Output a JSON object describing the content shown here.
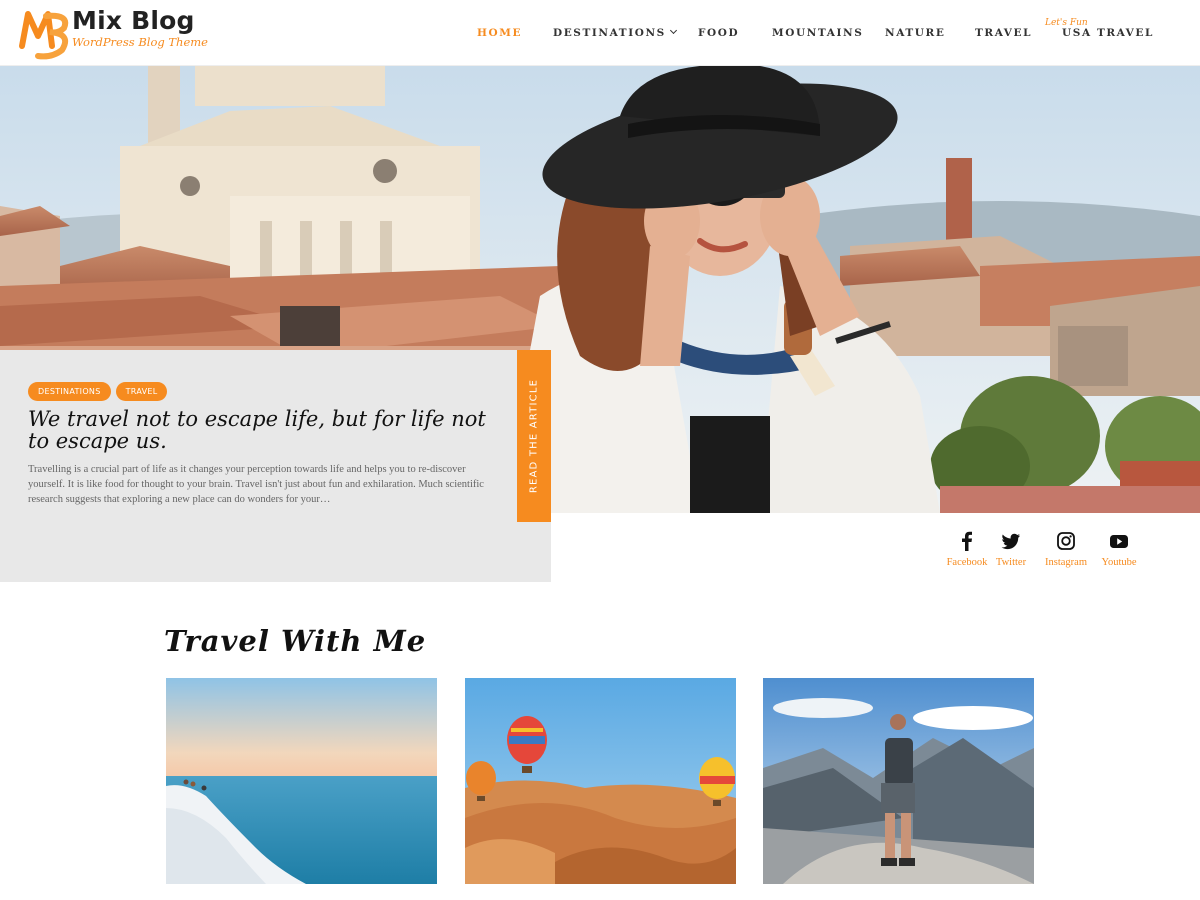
{
  "brand": {
    "title": "Mix Blog",
    "tagline": "WordPress Blog Theme",
    "logo_letters": "MB",
    "accent": "#f68b1f"
  },
  "nav": {
    "items": [
      {
        "label": "Home",
        "active": true
      },
      {
        "label": "Destinations",
        "has_dropdown": true
      },
      {
        "label": "Food"
      },
      {
        "label": "Mountains"
      },
      {
        "label": "Nature"
      },
      {
        "label": "Travel"
      },
      {
        "label": "USA Travel"
      }
    ],
    "sub_caption": "Let's Fun"
  },
  "hero": {
    "tags": [
      "DESTINATIONS",
      "TRAVEL"
    ],
    "title": "We travel not to escape life, but for life not to escape us.",
    "excerpt": "Travelling is a crucial part of life as it changes your perception towards life and helps you to re-discover yourself. It is like food for thought to your brain. Travel isn't just about fun and exhilaration. Much scientific research suggests that exploring a new place can do wonders for your…",
    "read_label": "READ THE ARTICLE"
  },
  "social": [
    {
      "label": "Facebook",
      "icon": "facebook-icon"
    },
    {
      "label": "Twitter",
      "icon": "twitter-icon"
    },
    {
      "label": "Instagram",
      "icon": "instagram-icon"
    },
    {
      "label": "Youtube",
      "icon": "youtube-icon"
    }
  ],
  "section": {
    "title": "Travel With Me",
    "thumbnails": [
      "sea-cliff-thumbnail",
      "desert-balloons-thumbnail",
      "mountain-hiker-thumbnail"
    ]
  }
}
